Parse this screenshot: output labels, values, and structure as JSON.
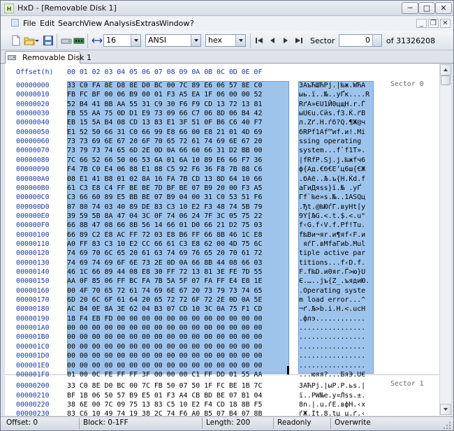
{
  "window": {
    "title": "HxD - [Removable Disk 1]",
    "min_glyph": "─",
    "max_glyph": "□",
    "close_glyph": "✕"
  },
  "menu": {
    "items": [
      "File",
      "Edit",
      "Search",
      "View",
      "Analysis",
      "Extras",
      "Window",
      "?"
    ],
    "mdi": [
      "_",
      "❐",
      "✕"
    ]
  },
  "toolbar": {
    "bytes_per_row": "16",
    "charset": "ANSI",
    "offset_base": "hex",
    "sector_label": "Sector",
    "sector_value": "0",
    "sector_total": "of 31326208"
  },
  "tab": {
    "label": "Removable Disk 1"
  },
  "editor": {
    "header_offset": "Offset(h)",
    "column_header": "00 01 02 03 04 05 06 07 08 09 0A 0B 0C 0D 0E 0F",
    "sector_labels": [
      "Sector 0",
      "Sector 1"
    ],
    "rows": [
      {
        "offset": "00000000",
        "hex": "33 C0 FA 8E D8 8E D0 BC 00 7C 89 E6 06 57 8E C0",
        "ascii": "3АъЋШЋРј.|‰ж.WЋА"
      },
      {
        "offset": "00000010",
        "hex": "FB FC BF 00 06 B9 00 01 F3 A5 EA 1F 06 00 00 52",
        "ascii": "ыь.ї..№..уҐк....R"
      },
      {
        "offset": "00000020",
        "hex": "52 B4 41 BB AA 55 31 C9 30 F6 F9 CD 13 72 13 81",
        "ascii": "RґA»ЄU1Й0цщН.r.Ѓ"
      },
      {
        "offset": "00000030",
        "hex": "FB 55 AA 75 0D D1 E9 73 09 66 C7 06 8D 06 B4 42",
        "ascii": "ыUЄu.Сйs.fЗ.Ќ.ґB"
      },
      {
        "offset": "00000040",
        "hex": "EB 15 5A B4 08 CD 13 83 E1 3F 51 0F B6 C6 40 F7",
        "ascii": "л.Zґ.Н.ѓб?Q.¶Ж@ч"
      },
      {
        "offset": "00000050",
        "hex": "E1 52 50 66 31 C0 66 99 E8 66 00 E8 21 01 4D 69",
        "ascii": "бRPf1Аf™иf.и!.Mi"
      },
      {
        "offset": "00000060",
        "hex": "73 73 69 6E 67 20 6F 70 65 72 61 74 69 6E 67 20",
        "ascii": "ssing operating "
      },
      {
        "offset": "00000070",
        "hex": "73 79 73 74 65 6D 2E 0D 0A 66 60 66 31 D2 BB 00",
        "ascii": "system...f`f1Т»."
      },
      {
        "offset": "00000080",
        "hex": "7C 66 52 66 50 06 53 6A 01 6A 10 89 E6 66 F7 36",
        "ascii": "|fRfP.Sj.j.‰жfч6"
      },
      {
        "offset": "00000090",
        "hex": "F4 7B C0 E4 06 88 E1 88 C5 92 F6 36 F8 7B 88 C6",
        "ascii": "ф{Ад.€б€Е’ц6ш{€Ж"
      },
      {
        "offset": "000000A0",
        "hex": "08 E1 41 B8 01 02 8A 16 FA 7B CD 13 8D 64 10 66",
        "ascii": ".бAё..Љ.ъ{Н.Ќd.f"
      },
      {
        "offset": "000000B0",
        "hex": "61 C3 E8 C4 FF BE BE 7D BF BE 07 B9 20 00 F3 A5",
        "ascii": "aГиДяѕѕ}ї.№ .уҐ"
      },
      {
        "offset": "000000C0",
        "hex": "C3 66 60 89 E5 BB BE 07 B9 04 00 31 C0 53 51 F6",
        "ascii": "Гf`‰е»ѕ.№..1АSQц"
      },
      {
        "offset": "000000D0",
        "hex": "07 80 74 03 40 89 DE 83 C3 10 E2 F3 48 74 5B 79",
        "ascii": ".Ђt.@‰ЮѓГ.вуHt[y"
      },
      {
        "offset": "000000E0",
        "hex": "39 59 5B 8A 47 04 3C 0F 74 06 24 7F 3C 05 75 22",
        "ascii": "9Y[ЉG.<.t.$.<.u\""
      },
      {
        "offset": "000000F0",
        "hex": "66 8B 47 08 66 8B 56 14 66 01 D0 66 21 D2 75 03",
        "ascii": "f‹G.f‹V.f.Рf!Тu."
      },
      {
        "offset": "00000100",
        "hex": "66 89 C2 E8 AC FF 72 03 E8 B6 FF 66 8B 46 1C E8",
        "ascii": "f‰Ви¬яr.и¶яf‹F.и"
      },
      {
        "offset": "00000110",
        "hex": "A0 FF 83 C3 10 E2 CC 66 61 C3 E8 62 00 4D 75 6C",
        "ascii": " яѓГ.вМfaГиb.Mul"
      },
      {
        "offset": "00000120",
        "hex": "74 69 70 6C 65 20 61 63 74 69 76 65 20 70 61 72",
        "ascii": "tiple active par"
      },
      {
        "offset": "00000130",
        "hex": "74 69 74 69 6F 6E 73 2E 0D 0A 66 8B 44 08 66 03",
        "ascii": "titions...f‹D.f."
      },
      {
        "offset": "00000140",
        "hex": "46 1C 66 89 44 08 E8 30 FF 72 13 81 3E FE 7D 55",
        "ascii": "F.f‰D.и0яr.Ѓ>ю}U"
      },
      {
        "offset": "00000150",
        "hex": "AA 0F 85 06 FF BC FA 7B 5A 5F 07 FA FF E4 E8 1E",
        "ascii": "Є.…..јъ{Z_.ъядиЮ."
      },
      {
        "offset": "00000160",
        "hex": "00 4F 70 65 72 61 74 69 6E 67 20 73 79 73 74 65",
        "ascii": ".Operating syste"
      },
      {
        "offset": "00000170",
        "hex": "6D 20 6C 6F 61 64 20 65 72 72 6F 72 2E 0D 0A 5E",
        "ascii": "m load error...^"
      },
      {
        "offset": "00000180",
        "hex": "AC B4 0E 8A 3E 62 04 B3 07 CD 10 3C 0A 75 F1 CD",
        "ascii": "¬ґ.Љ>b.і.Н.<.uсН"
      },
      {
        "offset": "00000190",
        "hex": "18 F4 EB FD 00 00 00 00 00 00 00 00 00 00 00 00",
        "ascii": ".флэ............"
      },
      {
        "offset": "000001A0",
        "hex": "00 00 00 00 00 00 00 00 00 00 00 00 00 00 00 00",
        "ascii": "................"
      },
      {
        "offset": "000001B0",
        "hex": "00 00 00 00 00 00 00 00 00 00 00 00 00 00 00 00",
        "ascii": "................"
      },
      {
        "offset": "000001C0",
        "hex": "00 00 00 00 00 00 00 00 00 00 00 00 00 00 00 00",
        "ascii": "................"
      },
      {
        "offset": "000001D0",
        "hex": "00 00 00 00 00 00 00 00 00 00 00 00 00 00 00 00",
        "ascii": "................"
      },
      {
        "offset": "000001E0",
        "hex": "00 00 00 00 00 00 00 00 00 00 00 00 00 00 00 00",
        "ascii": "................"
      },
      {
        "offset": "000001F0",
        "hex": "01 00 0C FE FF FF 3F 00 00 00 C1 FF DD 01 55 AA",
        "ascii": "...юяя?...БяЭ.UЄ"
      },
      {
        "offset": "00000200",
        "hex": "33 C0 8E D0 BC 00 7C FB 50 07 50 1F FC BE 1B 7C",
        "ascii": "3АЋРј.|ыP.P.ьѕ.|"
      },
      {
        "offset": "00000210",
        "hex": "BF 1B 06 50 57 B9 E5 01 F3 A4 CB BD BE 07 B1 04",
        "ascii": "ї..PW№е.у¤Лѕѕ.±."
      },
      {
        "offset": "00000220",
        "hex": "38 6E 00 7C 09 75 13 83 C5 10 E2 F4 CD 18 8B F5",
        "ascii": "8n.|.u.ѓЕ.вфН.‹х"
      },
      {
        "offset": "00000230",
        "hex": "83 C6 10 49 74 19 38 2C 74 F6 A0 B5 07 B4 07 8B",
        "ascii": "ѓЖ.It.8,tц µ.ґ.‹"
      }
    ]
  },
  "statusbar": {
    "offset": "Offset: 0",
    "block": "Block: 0-1FF",
    "length": "Length: 200",
    "mode": "Readonly",
    "overwrite": "Overwrite"
  },
  "colors": {
    "selection": "#9ec4ec",
    "offset_text": "#1a38a8"
  }
}
